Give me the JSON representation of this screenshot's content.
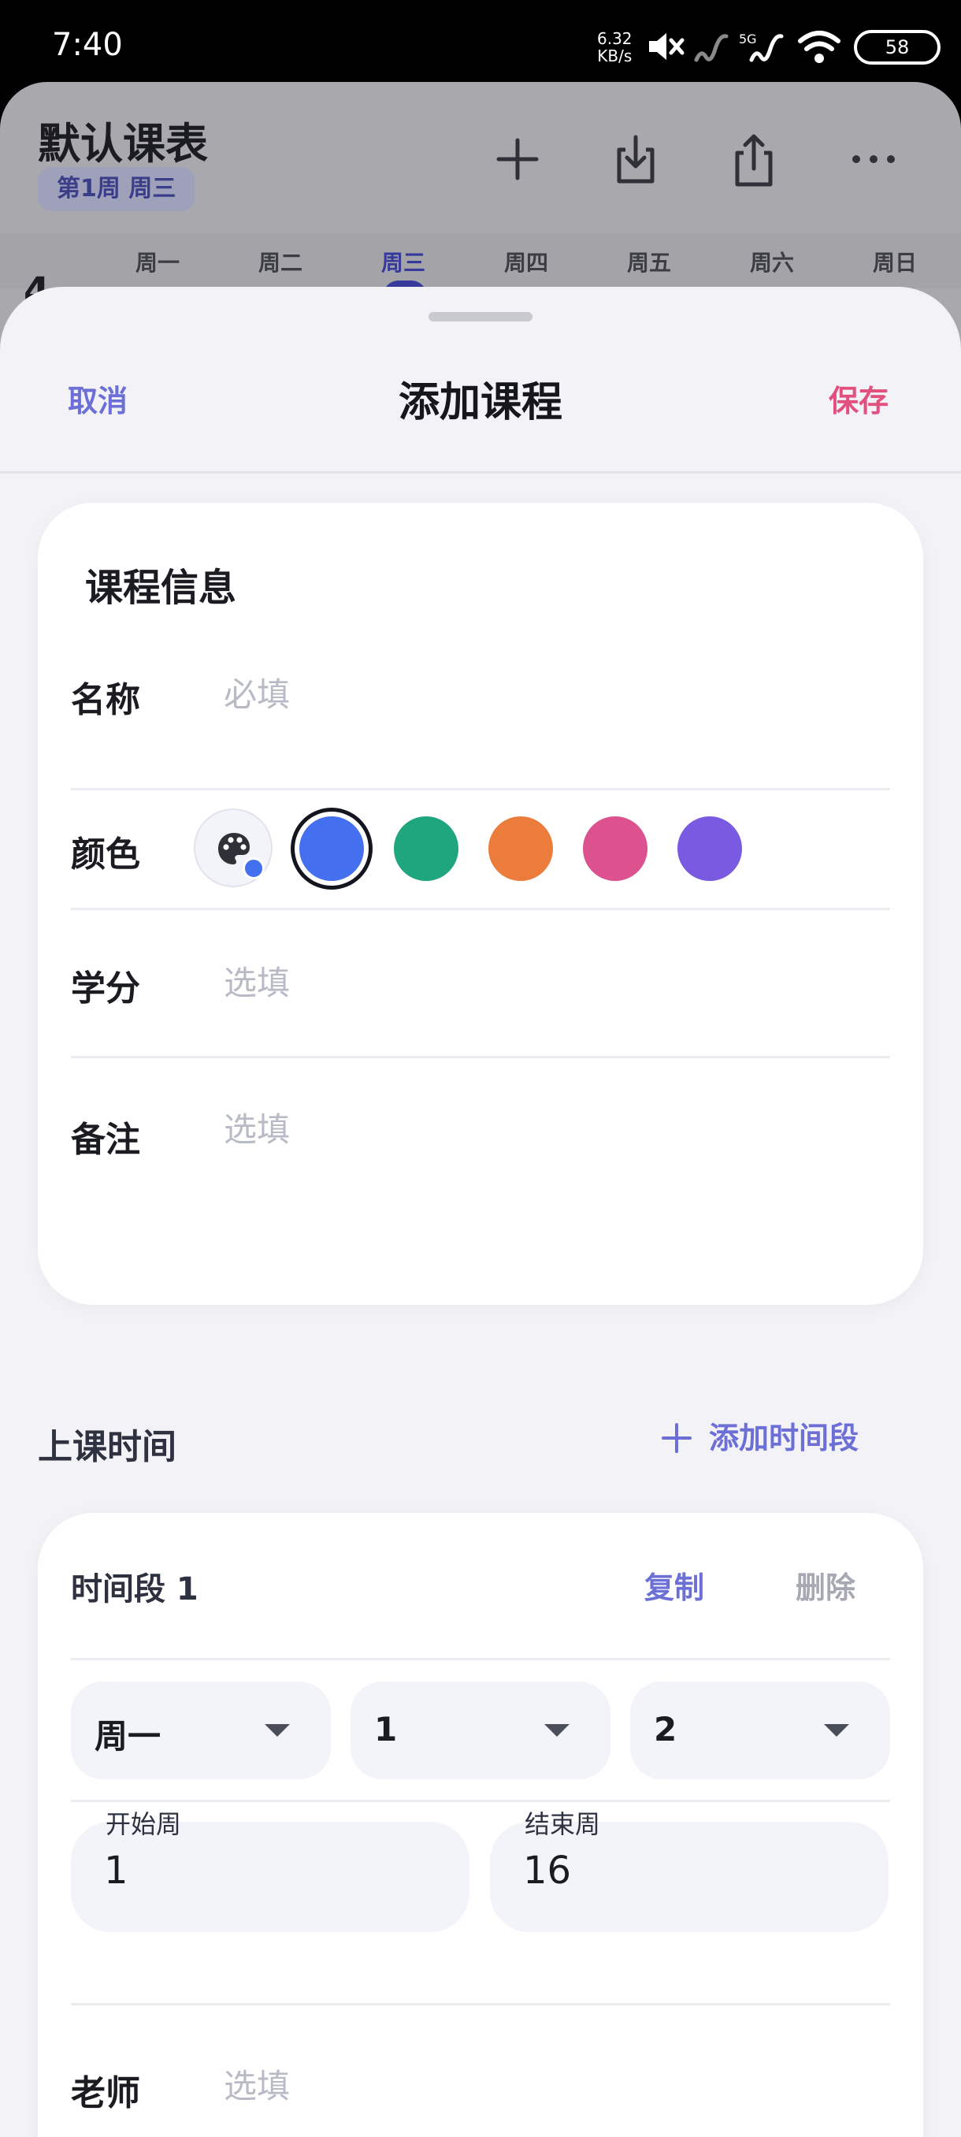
{
  "status_bar": {
    "time": "7:40",
    "net_speed_value": "6.32",
    "net_speed_unit": "KB/s",
    "signal_label": "5G",
    "battery": "58",
    "icons": [
      "mute-icon",
      "signal-icon",
      "5g-signal-icon",
      "wifi-icon",
      "battery-icon"
    ]
  },
  "background_app": {
    "title": "默认课表",
    "week_badge": "第1周 周三",
    "toolbar_icons": [
      "plus-icon",
      "import-icon",
      "share-icon",
      "more-icon"
    ],
    "days": [
      "周一",
      "周二",
      "周三",
      "周四",
      "周五",
      "周六",
      "周日"
    ],
    "active_day": "周三",
    "row_number": "4"
  },
  "sheet": {
    "cancel_label": "取消",
    "title": "添加课程",
    "save_label": "保存",
    "info_card": {
      "title": "课程信息",
      "name_label": "名称",
      "name_placeholder": "必填",
      "color_label": "颜色",
      "colors": [
        "#4470ef",
        "#1fa67e",
        "#ec7c3c",
        "#db528f",
        "#7a5ae0"
      ],
      "selected_color": "#4470ef",
      "credit_label": "学分",
      "credit_placeholder": "选填",
      "note_label": "备注",
      "note_placeholder": "选填"
    },
    "schedule": {
      "section_title": "上课时间",
      "add_slot_label": "添加时间段",
      "slot": {
        "title": "时间段 1",
        "copy_label": "复制",
        "delete_label": "删除",
        "day_value": "周一",
        "start_period": "1",
        "end_period": "2",
        "start_week_label": "开始周",
        "start_week_value": "1",
        "end_week_label": "结束周",
        "end_week_value": "16",
        "teacher_label": "老师",
        "teacher_placeholder": "选填"
      }
    }
  }
}
